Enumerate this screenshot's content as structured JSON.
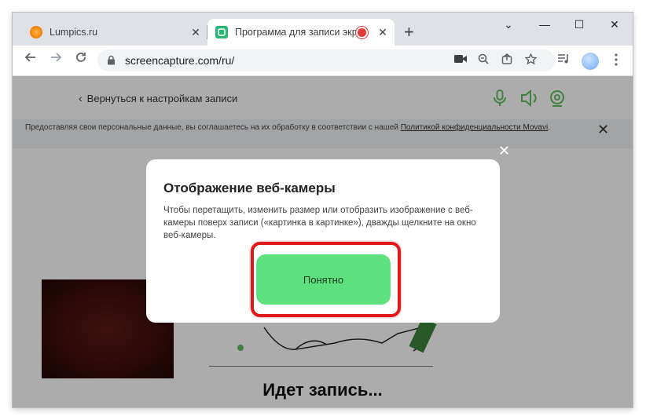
{
  "browser": {
    "tabs": [
      {
        "title": "Lumpics.ru",
        "favicon": "orange-favicon",
        "active": false
      },
      {
        "title": "Программа для записи экра",
        "favicon": "screencapture-favicon",
        "active": true,
        "recording_indicator": true
      }
    ],
    "new_tab_label": "+",
    "window_controls": {
      "expand": "⌄",
      "minimize": "—",
      "maximize": "☐",
      "close": "✕"
    },
    "url": "screencapture.com/ru/"
  },
  "page": {
    "back_link": "Вернуться к настройкам записи",
    "cookie_notice": {
      "text": "Предоставляя свои персональные данные, вы соглашаетесь на их обработку в соответствии с нашей ",
      "link_text": "Политикой конфиденциальности Movavi",
      "suffix": "."
    },
    "recording_title": "Идет запись...",
    "accent_color": "#5cb85c"
  },
  "modal": {
    "title": "Отображение веб-камеры",
    "body": "Чтобы перетащить, изменить размер или отобразить изображение с веб-камеры поверх записи («картинка в картинке»), дважды щелкните на окно веб-камеры.",
    "ok_button": "Понятно",
    "close_symbol": "✕",
    "button_color": "#5ee07f",
    "highlight_color": "#e01919"
  }
}
